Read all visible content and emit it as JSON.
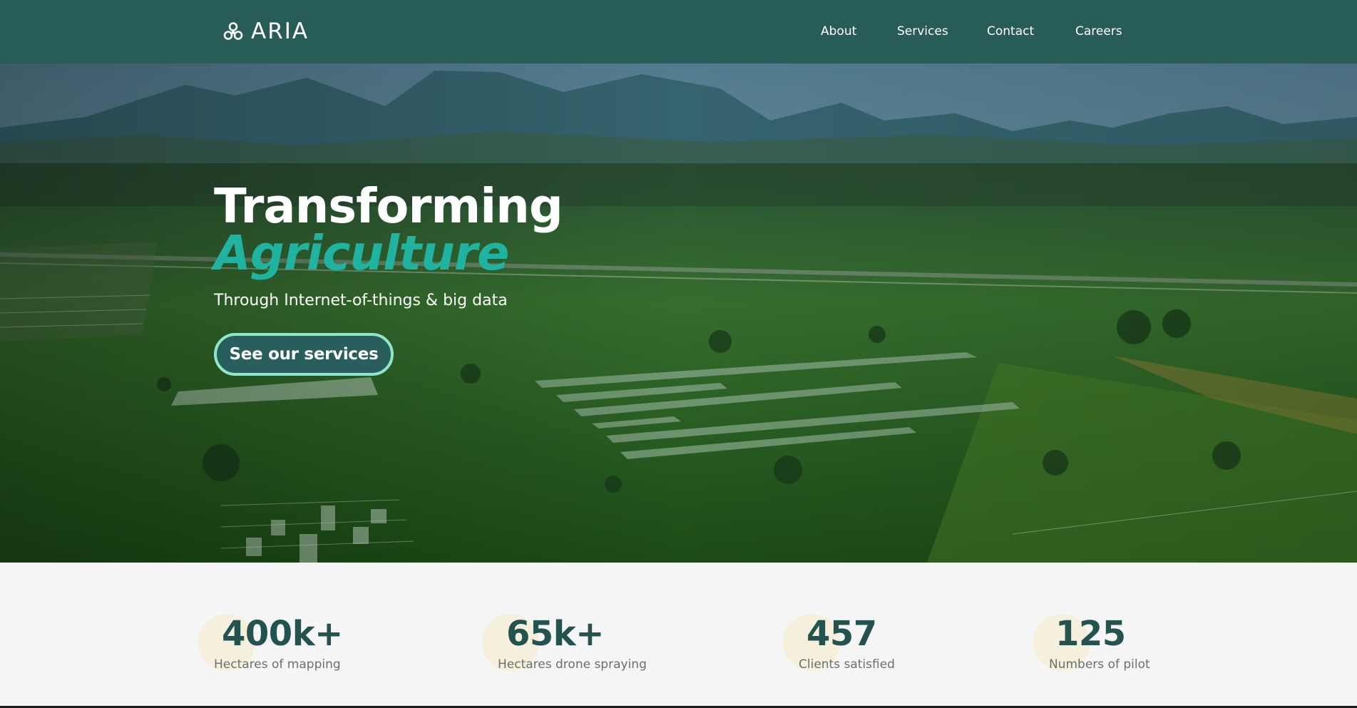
{
  "navbar": {
    "brand": "ARIA",
    "links": [
      "About",
      "Services",
      "Contact",
      "Careers"
    ]
  },
  "hero": {
    "title": "Transforming",
    "title_accent": "Agriculture",
    "subtitle": "Through Internet-of-things & big data",
    "cta_label": "See our services"
  },
  "stats": [
    {
      "value": "400k+",
      "label": "Hectares of mapping"
    },
    {
      "value": "65k+",
      "label": "Hectares drone spraying"
    },
    {
      "value": "457",
      "label": "Clients satisfied"
    },
    {
      "value": "125",
      "label": "Numbers of pilot"
    }
  ],
  "colors": {
    "nav_bg": "#275c57",
    "accent": "#20b3a0",
    "cta_border": "#8fe6c9",
    "stat_value": "#23524f",
    "stat_circle": "#f5f0dc",
    "stats_bg": "#f5f5f5"
  },
  "icons": {
    "brand": "trefoil-logo-icon"
  }
}
